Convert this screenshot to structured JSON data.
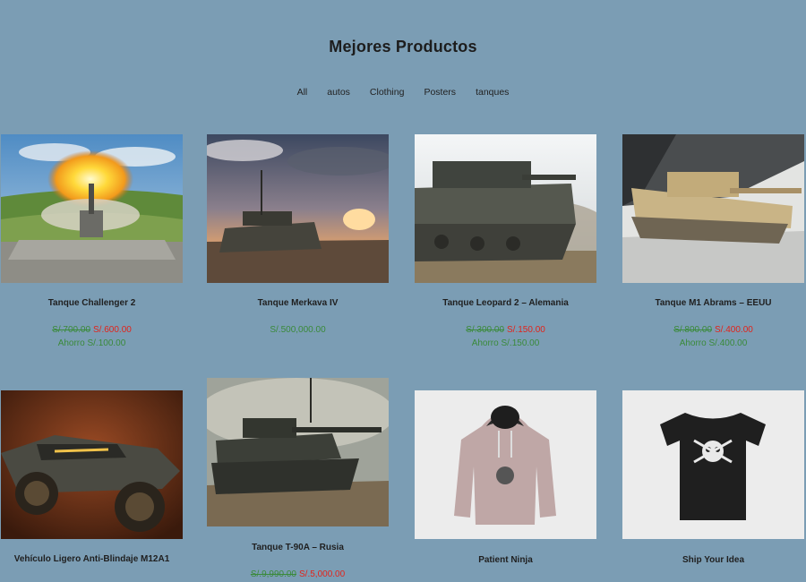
{
  "header": {
    "title": "Mejores Productos"
  },
  "filters": [
    "All",
    "autos",
    "Clothing",
    "Posters",
    "tanques"
  ],
  "products": [
    {
      "name": "Tanque Challenger 2",
      "old_price": "S/.700.00",
      "price": "S/.600.00",
      "savings": "Ahorro S/.100.00",
      "image": "tank-firing-image"
    },
    {
      "name": "Tanque Merkava IV",
      "regular_price": "S/.500,000.00",
      "image": "tank-sunset-image"
    },
    {
      "name": "Tanque Leopard 2 – Alemania",
      "old_price": "S/.300.00",
      "price": "S/.150.00",
      "savings": "Ahorro S/.150.00",
      "image": "tank-dust-image"
    },
    {
      "name": "Tanque M1 Abrams – EEUU",
      "old_price": "S/.800.00",
      "price": "S/.400.00",
      "savings": "Ahorro S/.400.00",
      "image": "tank-aircraft-image"
    },
    {
      "name": "Vehículo Ligero Anti-Blindaje M12A1",
      "image": "armored-vehicle-image"
    },
    {
      "name": "Tanque T-90A – Rusia",
      "old_price": "S/.9,990.00",
      "price": "S/.5,000.00",
      "image": "tank-mud-image"
    },
    {
      "name": "Patient Ninja",
      "image": "hoodie-image"
    },
    {
      "name": "Ship Your Idea",
      "image": "tshirt-image"
    }
  ]
}
